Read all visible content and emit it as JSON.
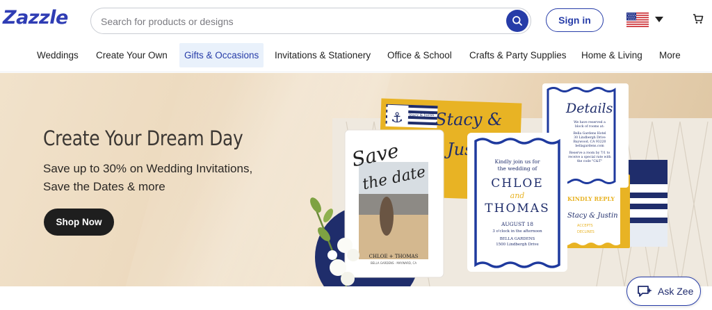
{
  "header": {
    "logo": "Zazzle",
    "search_placeholder": "Search for products or designs",
    "signin_label": "Sign in"
  },
  "nav": {
    "items": [
      {
        "label": "Weddings"
      },
      {
        "label": "Create Your Own"
      },
      {
        "label": "Gifts & Occasions",
        "active": true
      },
      {
        "label": "Invitations & Stationery"
      },
      {
        "label": "Office & School"
      },
      {
        "label": "Crafts & Party Supplies"
      },
      {
        "label": "Home & Living"
      },
      {
        "label": "More"
      }
    ]
  },
  "hero": {
    "title": "Create Your Dream Day",
    "subtitle_line1": "Save up to 30% on Wedding Invitations,",
    "subtitle_line2": "Save the Dates & more",
    "cta": "Shop Now",
    "cards": {
      "save_the_date": {
        "script_line1": "Save",
        "script_line2": "the date",
        "names": "CHLOE + THOMAS",
        "venue": "BELLA GARDENS · MAYWARD, CA"
      },
      "main_invite": {
        "intro_line1": "Kindly join us for",
        "intro_line2": "the wedding of",
        "name1": "CHLOE",
        "and": "and",
        "name2": "THOMAS",
        "date": "AUGUST 18",
        "time": "3 o'clock in the afternoon",
        "venue": "BELLA GARDENS",
        "address": "1500 Lindbergh Drive"
      },
      "details": {
        "title": "Details",
        "lines": [
          "We have reserved a",
          "block of rooms at:",
          "Bella Gardens Hotel",
          "30 Lindbergh Drive",
          "Baywood, CA 93220",
          "bellagardens.com",
          "Reserve a room by 7/1 to",
          "receive a special rate with",
          "the code \"C&T\""
        ]
      },
      "yellow_envelope": {
        "script_line1": "Stacy &",
        "script_line2": "Justin",
        "label_text": "Stacy & Justin"
      },
      "rsvp": {
        "title": "KINDLY REPLY",
        "script": "Stacy & Justin",
        "line1": "ACCEPTS",
        "line2": "DECLINES"
      }
    }
  },
  "ask_zee": {
    "label": "Ask Zee"
  },
  "colors": {
    "brand_blue": "#263ca8",
    "navy": "#1f2d6b",
    "mustard": "#e8b324",
    "hero_bg": "#ecd9bd"
  }
}
